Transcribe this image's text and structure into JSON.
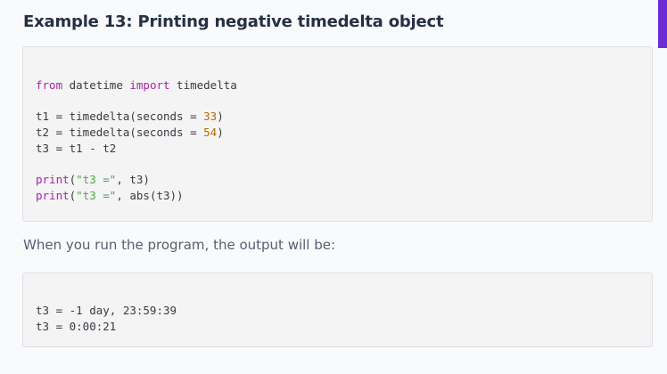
{
  "heading": "Example 13: Printing negative timedelta object",
  "accent_color": "#6c2dd9",
  "code_example": {
    "line1": {
      "kw1": "from",
      "module": " datetime ",
      "kw2": "import",
      "name": " timedelta"
    },
    "line2": {
      "pre": "t1 = timedelta(seconds = ",
      "num": "33",
      "post": ")"
    },
    "line3": {
      "pre": "t2 = timedelta(seconds = ",
      "num": "54",
      "post": ")"
    },
    "line4": {
      "text": "t3 = t1 - t2"
    },
    "line5": {
      "fn": "print",
      "open": "(",
      "str": "\"t3 =\"",
      "post": ", t3)"
    },
    "line6": {
      "fn": "print",
      "open": "(",
      "str": "\"t3 =\"",
      "post": ", abs(t3))"
    }
  },
  "output_intro": "When you run the program, the output will be:",
  "output_lines": [
    "t3 = -1 day, 23:59:39",
    "t3 = 0:00:21"
  ]
}
